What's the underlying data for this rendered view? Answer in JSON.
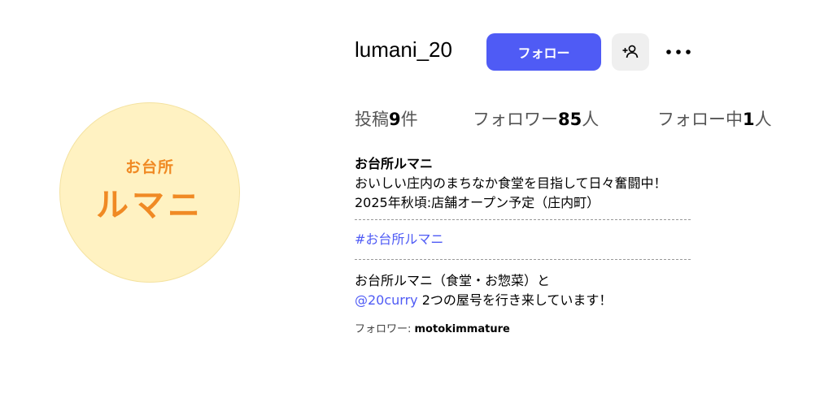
{
  "avatar": {
    "text_small": "お台所",
    "text_big": "ルマニ",
    "bg_color": "#fff2c2",
    "text_color": "#f08a24"
  },
  "header": {
    "username": "lumani_20",
    "follow_label": "フォロー",
    "suggest_icon": "person-add-icon",
    "more_icon": "more-horizontal-icon",
    "accent_color": "#4f5bf5"
  },
  "stats": {
    "posts_label": "投稿",
    "posts_count": "9",
    "posts_unit": "件",
    "followers_label": "フォロワー",
    "followers_count": "85",
    "followers_unit": "人",
    "following_label": "フォロー中",
    "following_count": "1",
    "following_unit": "人"
  },
  "bio": {
    "name": "お台所ルマニ",
    "line1": "おいしい庄内のまちなか食堂を目指して日々奮闘中！",
    "line2": "2025年秋頃:店舗オープン予定（庄内町）",
    "hashtag": "#お台所ルマニ",
    "line3": "お台所ルマニ（食堂・お惣菜）と",
    "mention": "@20curry",
    "line4_rest": " 2つの屋号を行き来しています！",
    "followed_by_label": "フォロワー: ",
    "followed_by_user": "motokimmature"
  }
}
